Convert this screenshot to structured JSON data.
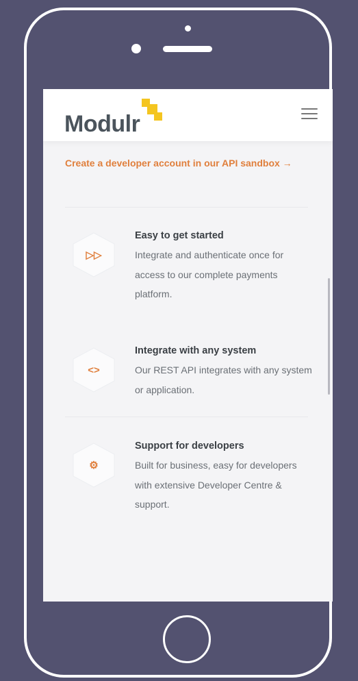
{
  "header": {
    "logo_text": "Modulr",
    "menu_icon": "hamburger-menu-icon"
  },
  "cta": {
    "label": "Create a developer account in our API sandbox →"
  },
  "features": [
    {
      "icon": "fast-forward-icon",
      "glyph": "▷▷",
      "title": "Easy to get started",
      "description": "Integrate and authenticate once for access to our complete payments platform."
    },
    {
      "icon": "code-brackets-icon",
      "glyph": "<>",
      "title": "Integrate with any system",
      "description": "Our REST API integrates with any system or application."
    },
    {
      "icon": "gear-icon",
      "glyph": "⚙",
      "title": "Support for developers",
      "description": "Built for business, easy for developers with extensive Developer Centre & support."
    }
  ],
  "colors": {
    "accent": "#e07f3c",
    "logo_yellow": "#f4c520",
    "device_background": "#535270"
  }
}
